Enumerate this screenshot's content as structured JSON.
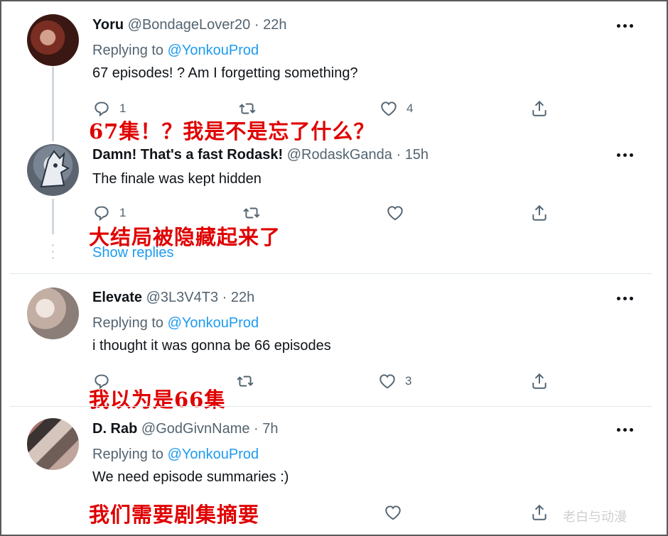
{
  "tweets": [
    {
      "name": "Yoru",
      "handle": "@BondageLover20",
      "sep": "·",
      "time": "22h",
      "replying_label": "Replying to",
      "replying_mention": "@YonkouProd",
      "text": "67 episodes! ? Am I forgetting something?",
      "reply_count": "1",
      "retweet_count": "",
      "like_count": "4",
      "translation": "67集！？我是不是忘了什么？"
    },
    {
      "name": "Damn! That's a fast Rodask!",
      "handle": "@RodaskGanda",
      "sep": "·",
      "time": "15h",
      "text": "The finale was kept hidden",
      "reply_count": "1",
      "retweet_count": "",
      "like_count": "",
      "translation": "大结局被隐藏起来了",
      "show_replies": "Show replies"
    },
    {
      "name": "Elevate",
      "handle": "@3L3V4T3",
      "sep": "·",
      "time": "22h",
      "replying_label": "Replying to",
      "replying_mention": "@YonkouProd",
      "text": "i thought it was gonna be 66 episodes",
      "reply_count": "",
      "retweet_count": "",
      "like_count": "3",
      "translation": "我以为是66集"
    },
    {
      "name": "D. Rab",
      "handle": "@GodGivnName",
      "sep": "·",
      "time": "7h",
      "replying_label": "Replying to",
      "replying_mention": "@YonkouProd",
      "text": "We need episode summaries :)",
      "translation": "我们需要剧集摘要"
    }
  ],
  "watermark": "老白与动漫",
  "icons": [
    "reply-icon",
    "retweet-icon",
    "like-icon",
    "share-icon",
    "more-icon"
  ],
  "colors": {
    "link": "#1d9bf0",
    "muted": "#536471",
    "text": "#0f1419",
    "annotation": "#e00000"
  }
}
